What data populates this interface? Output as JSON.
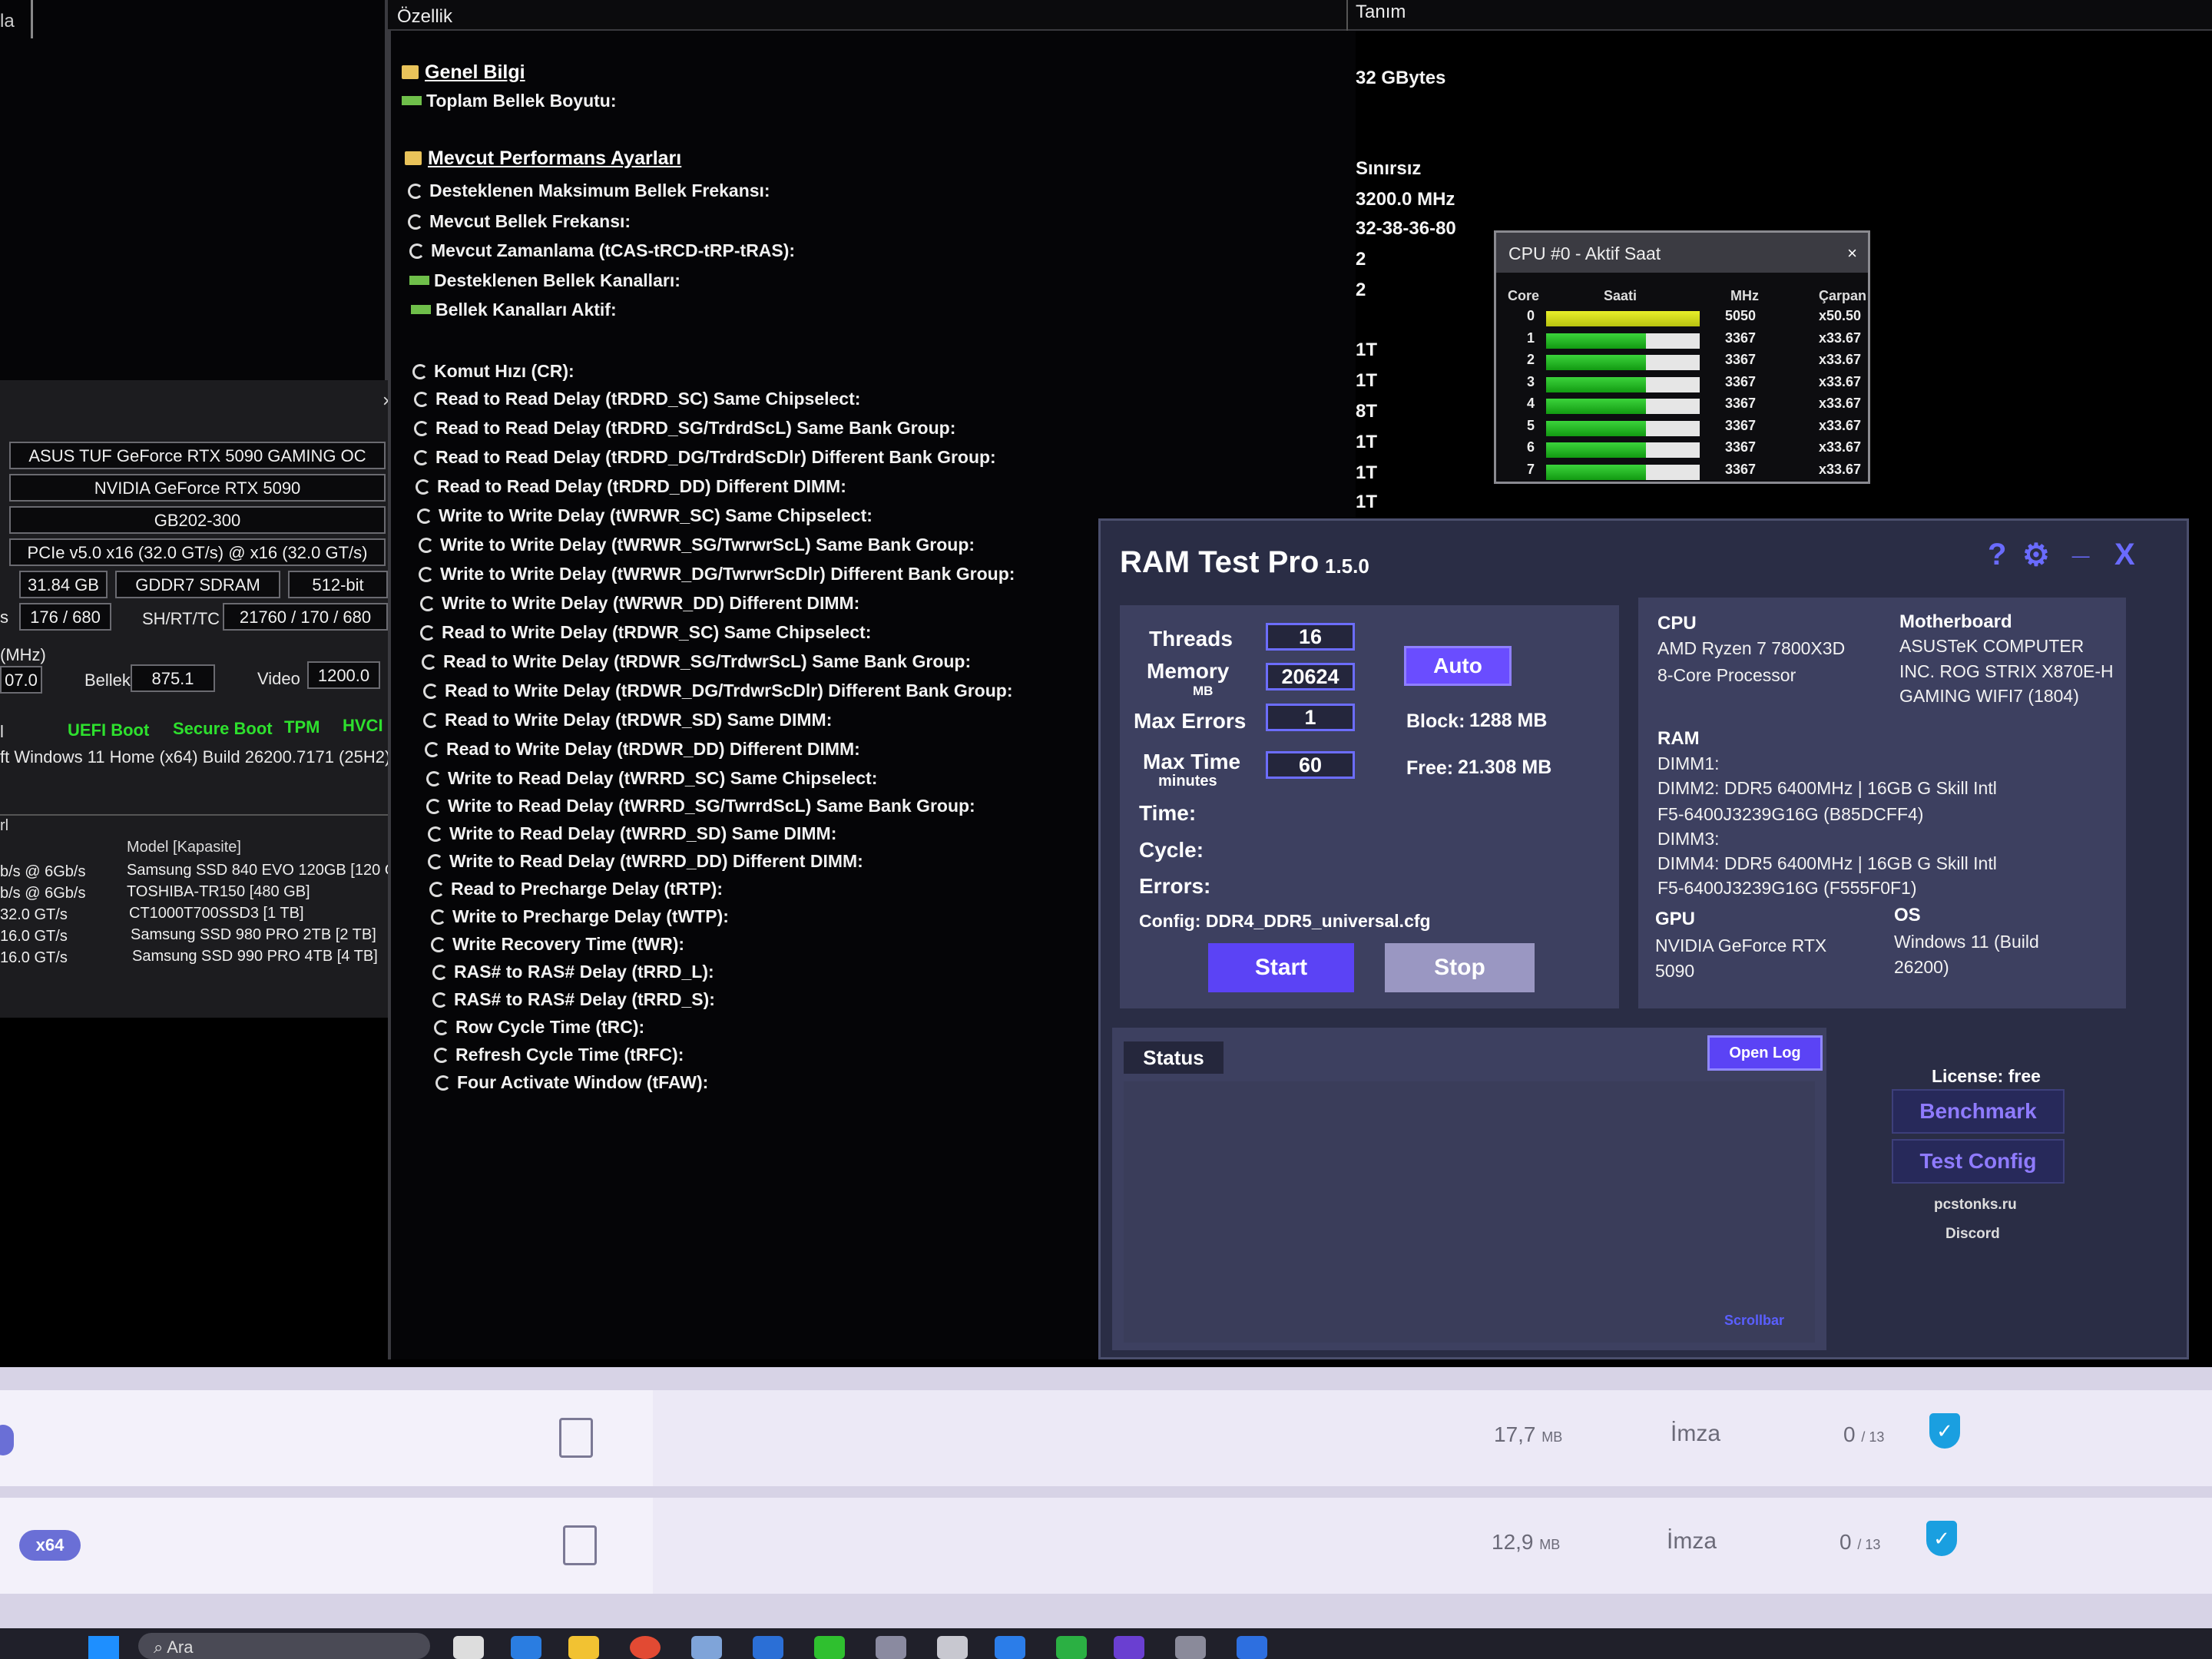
{
  "left_top": {
    "corner_label": "la"
  },
  "gpu_panel": {
    "close": "×",
    "card_name": "ASUS TUF GeForce RTX 5090 GAMING OC",
    "gpu_name": "NVIDIA GeForce RTX 5090",
    "gpu_code": "GB202-300",
    "bus": "PCIe v5.0 x16 (32.0 GT/s) @ x16 (32.0 GT/s)",
    "vram_size": "31.84 GB",
    "vram_type": "GDDR7 SDRAM",
    "bus_width": "512-bit",
    "rops_label_prefix": "s",
    "rops": "176 / 680",
    "shrt_label": "SH/RT/TC",
    "shrt": "21760 / 170 / 680",
    "mhz_label": "(MHz)",
    "clock_val": "07.0",
    "mem_label": "Bellek",
    "mem_clock": "875.1",
    "video_label": "Video",
    "video_clock": "1200.0",
    "flag_prefix": "l",
    "flags": [
      "UEFI Boot",
      "Secure Boot",
      "TPM",
      "HVCI"
    ],
    "os": "ft Windows 11 Home (x64) Build 26200.7171 (25H2)"
  },
  "drives": {
    "section_label": "rl",
    "header": "Model [Kapasite]",
    "rows": [
      {
        "speed": "b/s @ 6Gb/s",
        "model": "Samsung SSD 840 EVO 120GB [120 GB]"
      },
      {
        "speed": "b/s @ 6Gb/s",
        "model": "TOSHIBA-TR150 [480 GB]"
      },
      {
        "speed": "32.0 GT/s",
        "model": "CT1000T700SSD3 [1 TB]"
      },
      {
        "speed": "16.0 GT/s",
        "model": "Samsung SSD 980 PRO 2TB [2 TB]"
      },
      {
        "speed": "16.0 GT/s",
        "model": "Samsung SSD 990 PRO 4TB [4 TB]"
      }
    ]
  },
  "props_header": {
    "col1": "Özellik",
    "col2": "Tanım"
  },
  "props": {
    "section1": "Genel Bilgi",
    "total_mem_label": "Toplam Bellek Boyutu:",
    "total_mem": "32 GBytes",
    "section2": "Mevcut Performans Ayarları",
    "items": [
      {
        "label": "Desteklenen Maksimum Bellek Frekansı:",
        "value": "Sınırsız"
      },
      {
        "label": "Mevcut Bellek Frekansı:",
        "value": "3200.0 MHz"
      },
      {
        "label": "Mevcut Zamanlama (tCAS-tRCD-tRP-tRAS):",
        "value": "32-38-36-80"
      },
      {
        "label": "Desteklenen Bellek Kanalları:",
        "value": "2"
      },
      {
        "label": "Bellek Kanalları Aktif:",
        "value": "2"
      }
    ],
    "timings": [
      {
        "label": "Komut Hızı (CR):",
        "value": "1T"
      },
      {
        "label": "Read to Read Delay (tRDRD_SC) Same Chipselect:",
        "value": "1T"
      },
      {
        "label": "Read to Read Delay (tRDRD_SG/TrdrdScL) Same Bank Group:",
        "value": "8T"
      },
      {
        "label": "Read to Read Delay (tRDRD_DG/TrdrdScDlr) Different Bank Group:",
        "value": "1T"
      },
      {
        "label": "Read to Read Delay (tRDRD_DD) Different DIMM:",
        "value": "1T"
      },
      {
        "label": "Write to Write Delay (tWRWR_SC) Same Chipselect:",
        "value": "1T"
      },
      {
        "label": "Write to Write Delay (tWRWR_SG/TwrwrScL) Same Bank Group:",
        "value": ""
      },
      {
        "label": "Write to Write Delay (tWRWR_DG/TwrwrScDlr) Different Bank Group:",
        "value": ""
      },
      {
        "label": "Write to Write Delay (tWRWR_DD) Different DIMM:",
        "value": ""
      },
      {
        "label": "Read to Write Delay (tRDWR_SC) Same Chipselect:",
        "value": ""
      },
      {
        "label": "Read to Write Delay (tRDWR_SG/TrdwrScL) Same Bank Group:",
        "value": ""
      },
      {
        "label": "Read to Write Delay (tRDWR_DG/TrdwrScDlr) Different Bank Group:",
        "value": ""
      },
      {
        "label": "Read to Write Delay (tRDWR_SD) Same DIMM:",
        "value": ""
      },
      {
        "label": "Read to Write Delay (tRDWR_DD) Different DIMM:",
        "value": ""
      },
      {
        "label": "Write to Read Delay (tWRRD_SC) Same Chipselect:",
        "value": ""
      },
      {
        "label": "Write to Read Delay (tWRRD_SG/TwrrdScL) Same Bank Group:",
        "value": ""
      },
      {
        "label": "Write to Read Delay (tWRRD_SD) Same DIMM:",
        "value": ""
      },
      {
        "label": "Write to Read Delay (tWRRD_DD) Different DIMM:",
        "value": ""
      },
      {
        "label": "Read to Precharge Delay (tRTP):",
        "value": ""
      },
      {
        "label": "Write to Precharge Delay (tWTP):",
        "value": ""
      },
      {
        "label": "Write Recovery Time (tWR):",
        "value": ""
      },
      {
        "label": "RAS# to RAS# Delay (tRRD_L):",
        "value": ""
      },
      {
        "label": "RAS# to RAS# Delay (tRRD_S):",
        "value": ""
      },
      {
        "label": "Row Cycle Time (tRC):",
        "value": ""
      },
      {
        "label": "Refresh Cycle Time (tRFC):",
        "value": ""
      },
      {
        "label": "Four Activate Window (tFAW):",
        "value": ""
      }
    ]
  },
  "cpu_clock": {
    "title": "CPU #0 - Aktif Saat",
    "close": "×",
    "headers": {
      "core": "Core",
      "clock": "Saati",
      "mhz": "MHz",
      "mult": "Çarpan"
    },
    "cores": [
      {
        "core": "0",
        "mhz": "5050",
        "mult": "x50.50",
        "level": 1.0
      },
      {
        "core": "1",
        "mhz": "3367",
        "mult": "x33.67",
        "level": 0.65
      },
      {
        "core": "2",
        "mhz": "3367",
        "mult": "x33.67",
        "level": 0.65
      },
      {
        "core": "3",
        "mhz": "3367",
        "mult": "x33.67",
        "level": 0.65
      },
      {
        "core": "4",
        "mhz": "3367",
        "mult": "x33.67",
        "level": 0.65
      },
      {
        "core": "5",
        "mhz": "3367",
        "mult": "x33.67",
        "level": 0.65
      },
      {
        "core": "6",
        "mhz": "3367",
        "mult": "x33.67",
        "level": 0.65
      },
      {
        "core": "7",
        "mhz": "3367",
        "mult": "x33.67",
        "level": 0.65
      }
    ]
  },
  "ram_test": {
    "title": "RAM Test Pro",
    "version": "1.5.0",
    "icons": {
      "help": "?",
      "settings": "⚙",
      "minimize": "_",
      "close": "X"
    },
    "threads_label": "Threads",
    "threads": "16",
    "memory_label": "Memory",
    "memory_unit": "MB",
    "memory": "20624",
    "max_errors_label": "Max Errors",
    "max_errors": "1",
    "max_time_label": "Max Time",
    "max_time_unit": "minutes",
    "max_time": "60",
    "auto_label": "Auto",
    "block_label": "Block:",
    "block_value": "1288 MB",
    "free_label": "Free:",
    "free_value": "21.308 MB",
    "time_label": "Time:",
    "cycle_label": "Cycle:",
    "errors_label": "Errors:",
    "config": "Config: DDR4_DDR5_universal.cfg",
    "start_label": "Start",
    "stop_label": "Stop",
    "sys": {
      "cpu_head": "CPU",
      "cpu_lines": [
        "AMD Ryzen 7 7800X3D",
        "8-Core Processor"
      ],
      "mb_head": "Motherboard",
      "mb_lines": [
        "ASUSTeK COMPUTER",
        "INC. ROG STRIX X870E-H",
        "GAMING WIFI7 (1804)"
      ],
      "ram_head": "RAM",
      "ram_lines": [
        "DIMM1:",
        "DIMM2: DDR5 6400MHz | 16GB G Skill Intl",
        "F5-6400J3239G16G (B85DCFF4)",
        "DIMM3:",
        "DIMM4: DDR5 6400MHz | 16GB G Skill Intl",
        "F5-6400J3239G16G (F555F0F1)"
      ],
      "gpu_head": "GPU",
      "gpu_lines": [
        "NVIDIA GeForce RTX",
        "5090"
      ],
      "os_head": "OS",
      "os_lines": [
        "Windows 11 (Build",
        "26200)"
      ]
    },
    "status_label": "Status",
    "open_log_label": "Open Log",
    "scrollbar_label": "Scrollbar",
    "license": "License: free",
    "benchmark_label": "Benchmark",
    "test_config_label": "Test Config",
    "site": "pcstonks.ru",
    "discord": "Discord"
  },
  "downloads": [
    {
      "size": "17,7",
      "size_unit": "MB",
      "sign": "İmza",
      "score": "0",
      "score_total": "/ 13",
      "pill": ""
    },
    {
      "size": "12,9",
      "size_unit": "MB",
      "sign": "İmza",
      "score": "0",
      "score_total": "/ 13",
      "pill": "x64"
    }
  ],
  "taskbar": {
    "search_placeholder": "Ara"
  },
  "colors": {
    "accent": "#5b43f5",
    "window_bg": "#2a2d45",
    "panel_bg": "#3d4060",
    "green_bar": "#129a12",
    "yellow_bar": "#e8ef2a",
    "shield": "#1a9fe0"
  }
}
